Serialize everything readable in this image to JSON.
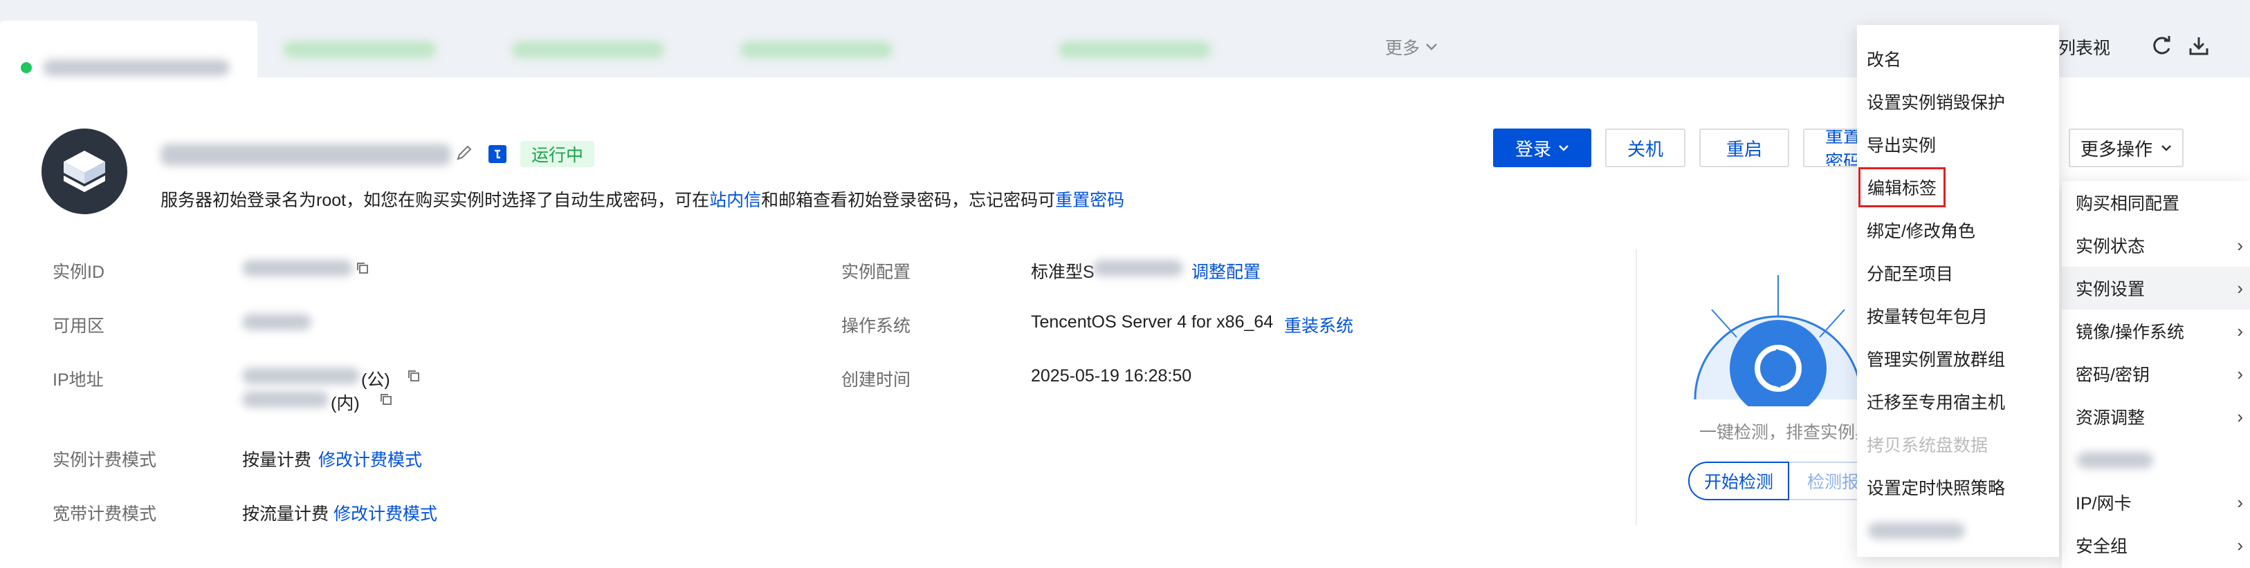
{
  "tabs": {
    "more_label": "更多",
    "list_view_label": "切换至列表视图"
  },
  "instance": {
    "status_label": "运行中",
    "notice_prefix": "服务器初始登录名为root，如您在购买实例时选择了自动生成密码，可在",
    "notice_link_inbox": "站内信",
    "notice_mid": "和邮箱查看初始登录密码，忘记密码可",
    "notice_link_reset": "重置密码"
  },
  "actions": {
    "login": "登录",
    "shutdown": "关机",
    "restart": "重启",
    "reset_password": "重置密码",
    "more_ops": "更多操作"
  },
  "details": {
    "id_label": "实例ID",
    "zone_label": "可用区",
    "ip_label": "IP地址",
    "ip_public_suffix": "(公)",
    "ip_private_suffix": "(内)",
    "billing_label": "实例计费模式",
    "billing_value": "按量计费",
    "billing_link": "修改计费模式",
    "bandwidth_label": "宽带计费模式",
    "bandwidth_value": "按流量计费",
    "bandwidth_link": "修改计费模式",
    "config_label": "实例配置",
    "config_value_prefix": "标准型S",
    "config_link": "调整配置",
    "os_label": "操作系统",
    "os_value": "TencentOS Server 4 for x86_64",
    "os_link": "重装系统",
    "created_label": "创建时间",
    "created_value": "2025-05-19 16:28:50"
  },
  "health": {
    "caption": "一键检测，排查实例异常",
    "start_button": "开始检测",
    "report_button": "检测报告"
  },
  "more_menu": {
    "items": [
      {
        "label": "购买相同配置",
        "has_sub": false
      },
      {
        "label": "实例状态",
        "has_sub": true
      },
      {
        "label": "实例设置",
        "has_sub": true
      },
      {
        "label": "镜像/操作系统",
        "has_sub": true
      },
      {
        "label": "密码/密钥",
        "has_sub": true
      },
      {
        "label": "资源调整",
        "has_sub": true
      },
      {
        "label": "",
        "has_sub": false
      },
      {
        "label": "IP/网卡",
        "has_sub": true
      },
      {
        "label": "安全组",
        "has_sub": true
      }
    ]
  },
  "settings_submenu": {
    "items": [
      {
        "label": "改名",
        "disabled": false
      },
      {
        "label": "设置实例销毁保护",
        "disabled": false
      },
      {
        "label": "导出实例",
        "disabled": false
      },
      {
        "label": "编辑标签",
        "disabled": false
      },
      {
        "label": "绑定/修改角色",
        "disabled": false
      },
      {
        "label": "分配至项目",
        "disabled": false
      },
      {
        "label": "按量转包年包月",
        "disabled": false
      },
      {
        "label": "管理实例置放群组",
        "disabled": false
      },
      {
        "label": "迁移至专用宿主机",
        "disabled": false
      },
      {
        "label": "拷贝系统盘数据",
        "disabled": true
      },
      {
        "label": "设置定时快照策略",
        "disabled": false
      }
    ],
    "highlight_color": "#e02020"
  },
  "colors": {
    "brand": "#0052d9",
    "running_green": "#1aa34a",
    "running_bg": "#e3f9e9"
  }
}
